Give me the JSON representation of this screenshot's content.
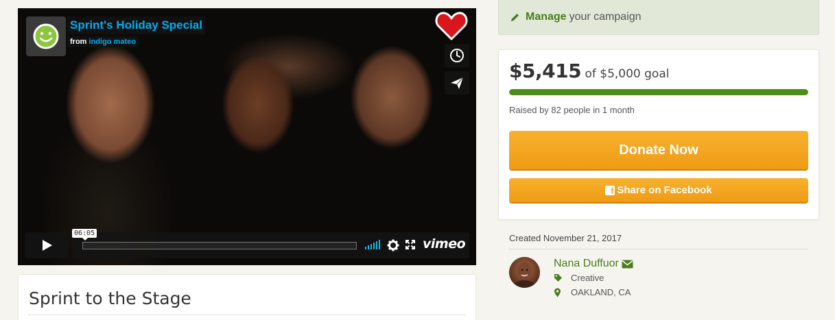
{
  "video": {
    "title": "Sprint's Holiday Special",
    "from_label": "from",
    "author": "indigo mateo",
    "timestamp": "06:05",
    "brand": "vimeo"
  },
  "project": {
    "title": "Sprint to the Stage"
  },
  "manage": {
    "strong": "Manage",
    "rest": "your campaign"
  },
  "donation": {
    "raised": "$5,415",
    "goal_text": "of $5,000 goal",
    "progress_fraction": 1.0,
    "raised_by": "Raised by 82 people in 1 month",
    "donate_label": "Donate Now",
    "share_label": "Share on Facebook"
  },
  "creator": {
    "created": "Created November 21, 2017",
    "name": "Nana Duffuor",
    "category": "Creative",
    "location": "OAKLAND, CA"
  },
  "colors": {
    "accent_green": "#4a7d1d",
    "button_orange": "#f0a11c",
    "vimeo_blue": "#00adef"
  },
  "icons": [
    "smiley-icon",
    "heart-icon",
    "clock-icon",
    "send-icon",
    "play-icon",
    "volume-icon",
    "gear-icon",
    "fullscreen-icon",
    "pencil-icon",
    "facebook-icon",
    "envelope-icon",
    "tag-icon",
    "map-pin-icon"
  ]
}
